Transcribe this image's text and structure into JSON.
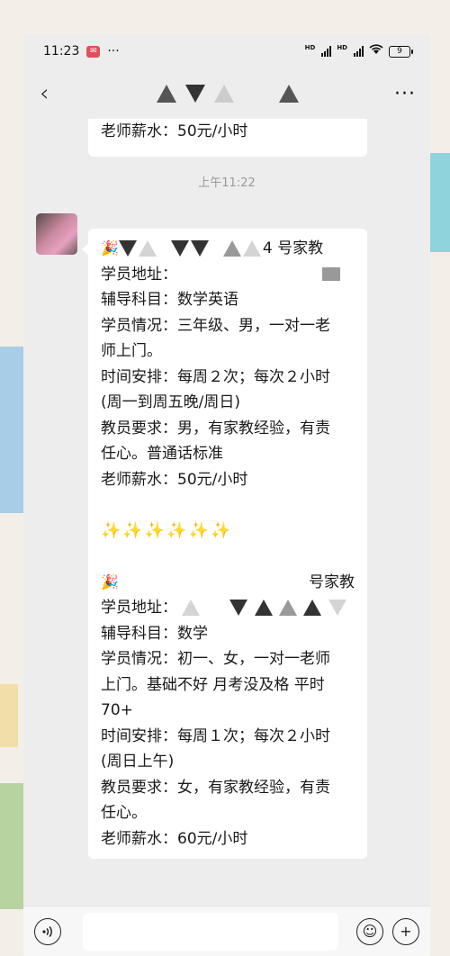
{
  "status_bar": {
    "time": "11:23",
    "notif_glyph": "✉",
    "more_dots": "···",
    "hd1": "HD",
    "hd2": "HD",
    "wifi_icon": "wifi-icon",
    "battery": "9"
  },
  "nav": {
    "back_glyph": "‹",
    "more_glyph": "···"
  },
  "chat": {
    "prev_message_tail": "老师薪水：50元/小时",
    "time_label": "上午11:22",
    "message": {
      "block1": {
        "header_suffix": "4 号家教",
        "address": "学员地址：",
        "subject": "辅导科目：数学英语",
        "situation_1": "学员情况：三年级、男，一对一老",
        "situation_2": "师上门。",
        "schedule_1": "时间安排：每周２次；每次２小时",
        "schedule_2": "(周一到周五晚/周日)",
        "requirement_1": "教员要求：男，有家教经验，有责",
        "requirement_2": "任心。普通话标准",
        "salary": "老师薪水：50元/小时"
      },
      "sparkles": "✨✨✨✨✨✨",
      "block2": {
        "header_suffix": "号家教",
        "address": "学员地址：",
        "subject": "辅导科目：数学",
        "situation_1": "学员情况：初一、女，一对一老师",
        "situation_2": "上门。基础不好 月考没及格 平时",
        "situation_3": "70+",
        "schedule_1": "时间安排：每周１次；每次２小时",
        "schedule_2": "(周日上午)",
        "requirement_1": "教员要求：女，有家教经验，有责",
        "requirement_2": "任心。",
        "salary": "老师薪水：60元/小时"
      }
    }
  },
  "input_bar": {
    "voice_glyph": "◉",
    "emoji_glyph": "☺",
    "plus_glyph": "+"
  }
}
